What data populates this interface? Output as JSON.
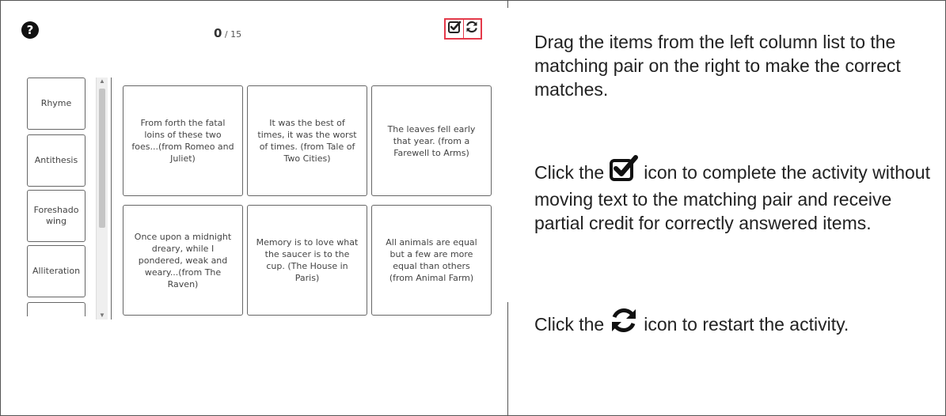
{
  "activity": {
    "score": {
      "current": "0",
      "total": " / 15"
    },
    "icons": {
      "help": "question-circle-icon",
      "check": "check-square-icon",
      "restart": "refresh-icon"
    },
    "accent_color": "#e43a4a",
    "left_items": [
      "Rhyme",
      "Antithesis",
      "Foreshado wing",
      "Alliteration",
      ""
    ],
    "targets": [
      "From forth the fatal loins of these two foes...(from Romeo and Juliet)",
      "It was the best of times, it was the worst of times. (from Tale of Two Cities)",
      "The leaves fell early that year. (from a Farewell to Arms)",
      "Once upon a midnight dreary, while I pondered, weak and weary...(from The Raven)",
      "Memory is to love what the saucer is to the cup. (The House in Paris)",
      "All animals are equal but a few are more equal than others (from Animal Farm)"
    ]
  },
  "instructions": {
    "p1": "Drag the items from the left column list to the matching pair on the right to make the correct matches.",
    "p2_before": "Click the",
    "p2_after": "icon to complete the activity without moving text to the matching pair and receive partial credit for correctly answered items.",
    "p3_before": "Click the",
    "p3_after": "icon to restart the activity."
  }
}
